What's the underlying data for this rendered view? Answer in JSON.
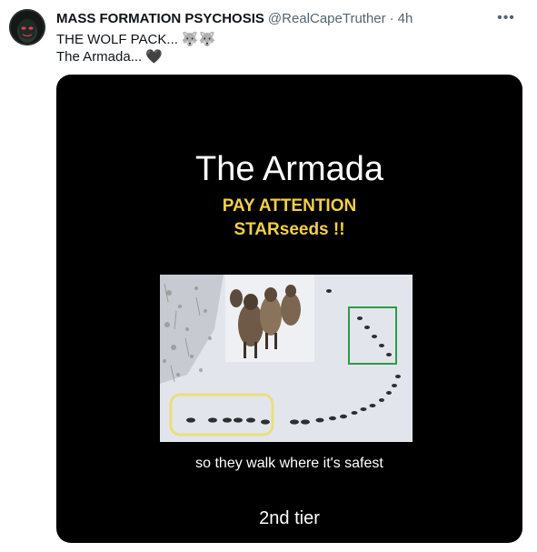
{
  "post": {
    "author_name": "MASS FORMATION PSYCHOSIS",
    "handle": "@RealCapeTruther",
    "separator": "·",
    "time": "4h",
    "more_label": "•••",
    "text_line1": "THE WOLF PACK...",
    "text_line1_emoji": "🐺🐺",
    "text_line2": "The Armada...",
    "text_line2_emoji": "🖤"
  },
  "video": {
    "title": "The Armada",
    "subtitle1": "PAY ATTENTION",
    "subtitle2": "STARseeds !!",
    "caption": "so they walk where it's safest",
    "tier_label": "2nd tier"
  },
  "colors": {
    "text_primary": "#0f1419",
    "text_secondary": "#536471",
    "video_background": "#000000",
    "highlight_yellow": "#f2cf4a",
    "box_yellow": "#e8e07a",
    "box_green": "#2e9a4a"
  },
  "icons": [
    "more-options-icon",
    "wolf-emoji",
    "black-heart-emoji"
  ]
}
